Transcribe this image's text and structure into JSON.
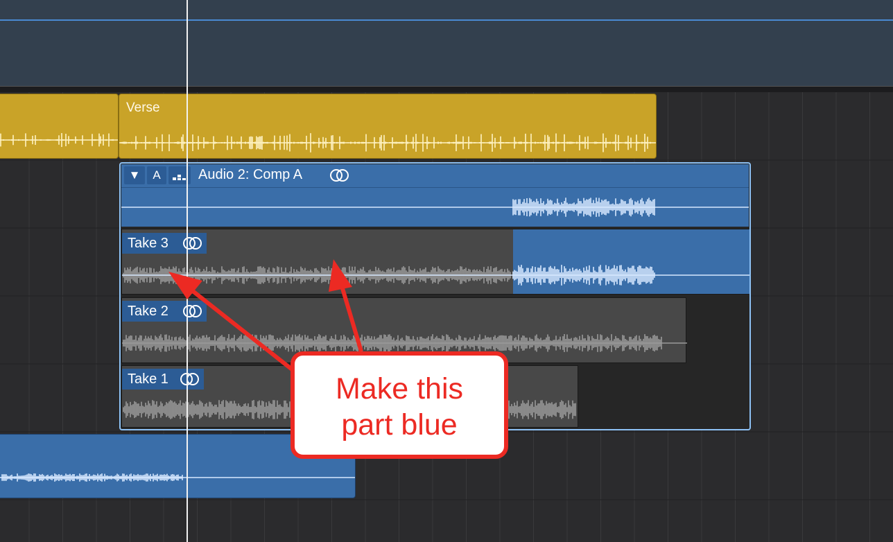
{
  "arrangement": {
    "verse_region": {
      "name": "Verse"
    },
    "comp_folder": {
      "buttons": {
        "disclosure": "▼",
        "automation": "A",
        "quick_swipe": ""
      },
      "name": "Audio 2: Comp A"
    },
    "takes": [
      {
        "label": "Take 3"
      },
      {
        "label": "Take 2"
      },
      {
        "label": "Take 1"
      }
    ]
  },
  "annotation": {
    "line1": "Make this",
    "line2": "part blue",
    "color": "#ec2a23"
  },
  "colors": {
    "region_yellow": "#c9a328",
    "region_blue": "#3a6ea9",
    "take_gray": "#484848",
    "selection_outline": "#8dc1f4"
  },
  "icons": {
    "loop": "linked-circles-icon",
    "disclosure": "triangle-down-icon",
    "quick_swipe": "flex-dots-icon"
  }
}
